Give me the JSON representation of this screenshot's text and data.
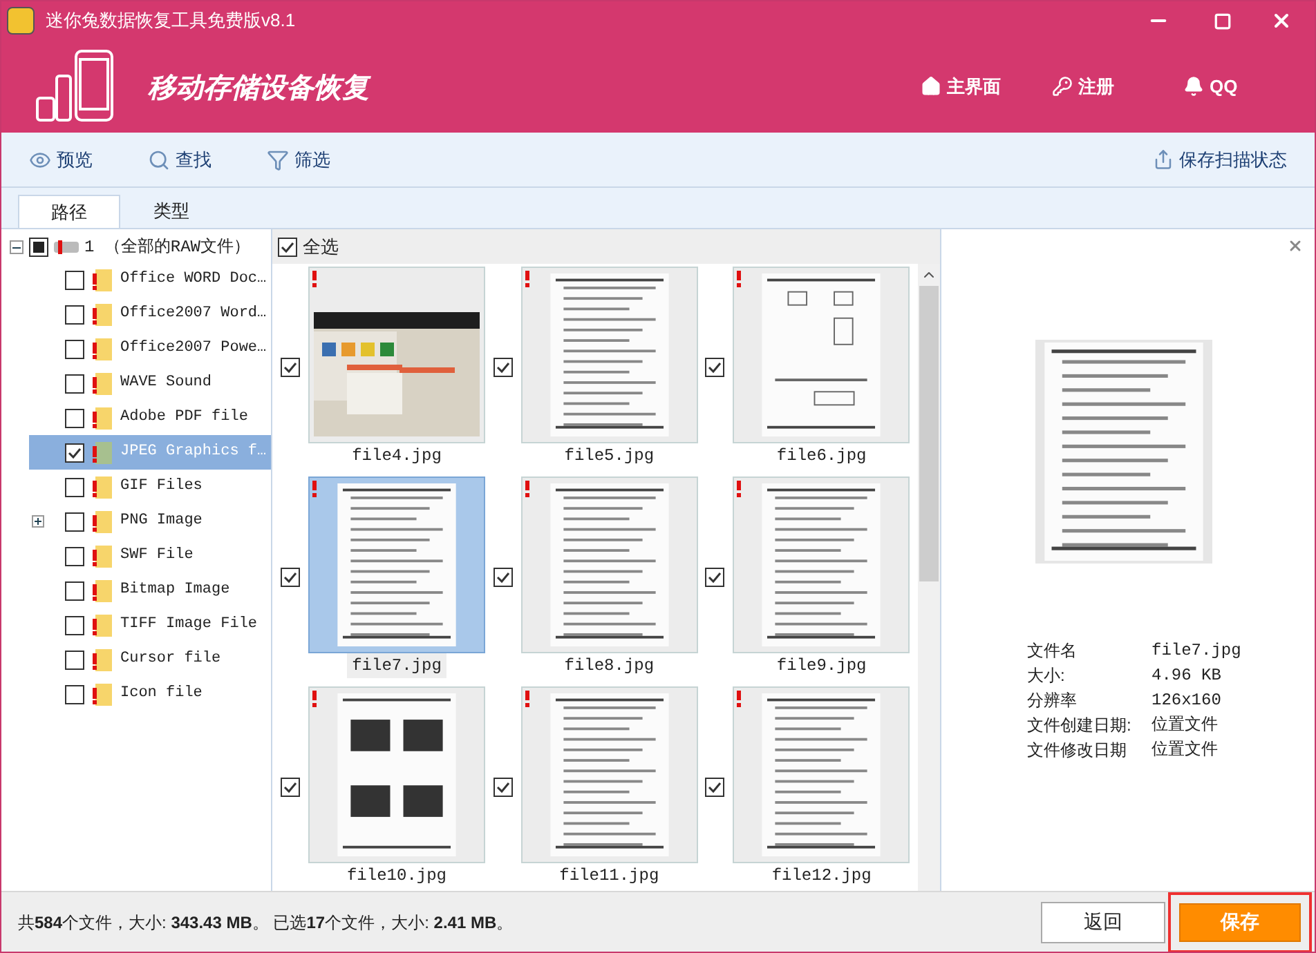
{
  "window": {
    "title": "迷你兔数据恢复工具免费版v8.1"
  },
  "header": {
    "title": "移动存储设备恢复",
    "nav": [
      {
        "kind": "home",
        "label": "主界面"
      },
      {
        "kind": "key",
        "label": "注册"
      },
      {
        "kind": "qq",
        "label": "QQ"
      }
    ]
  },
  "toolbar": {
    "items": [
      {
        "kind": "eye",
        "label": "预览"
      },
      {
        "kind": "search",
        "label": "查找"
      },
      {
        "kind": "filter",
        "label": "筛选"
      }
    ],
    "save_scan": "保存扫描状态"
  },
  "tabs": [
    {
      "label": "路径",
      "selected": true
    },
    {
      "label": "类型",
      "selected": false
    }
  ],
  "tree": {
    "label": "1 （全部的RAW文件）",
    "checked": true,
    "partial": true,
    "expanded": true,
    "children": [
      {
        "label": "Office WORD Doc…",
        "checked": false,
        "selected": false,
        "expandable": false
      },
      {
        "label": "Office2007 Word…",
        "checked": false,
        "selected": false,
        "expandable": false
      },
      {
        "label": "Office2007 Powe…",
        "checked": false,
        "selected": false,
        "expandable": false
      },
      {
        "label": "WAVE Sound",
        "checked": false,
        "selected": false,
        "expandable": false
      },
      {
        "label": "Adobe PDF file",
        "checked": false,
        "selected": false,
        "expandable": false
      },
      {
        "label": "JPEG Graphics f…",
        "checked": true,
        "selected": true,
        "expandable": false
      },
      {
        "label": "GIF Files",
        "checked": false,
        "selected": false,
        "expandable": false
      },
      {
        "label": "PNG Image",
        "checked": false,
        "selected": false,
        "expandable": true
      },
      {
        "label": "SWF File",
        "checked": false,
        "selected": false,
        "expandable": false
      },
      {
        "label": "Bitmap Image",
        "checked": false,
        "selected": false,
        "expandable": false
      },
      {
        "label": "TIFF Image File",
        "checked": false,
        "selected": false,
        "expandable": false
      },
      {
        "label": "Cursor file",
        "checked": false,
        "selected": false,
        "expandable": false
      },
      {
        "label": "Icon file",
        "checked": false,
        "selected": false,
        "expandable": false
      }
    ]
  },
  "grid": {
    "select_all": {
      "label": "全选",
      "checked": true
    },
    "files": [
      {
        "name": "file4.jpg",
        "checked": true,
        "selected": false
      },
      {
        "name": "file5.jpg",
        "kind": "document",
        "checked": true,
        "selected": false
      },
      {
        "name": "file6.jpg",
        "kind": "diagram",
        "checked": true,
        "selected": false
      },
      {
        "name": "file7.jpg",
        "kind": "document",
        "checked": true,
        "selected": true
      },
      {
        "name": "file8.jpg",
        "kind": "document",
        "checked": true,
        "selected": false
      },
      {
        "name": "file9.jpg",
        "kind": "document",
        "checked": true,
        "selected": false
      },
      {
        "name": "file10.jpg",
        "kind": "slides",
        "checked": true,
        "selected": false
      },
      {
        "name": "file11.jpg",
        "kind": "document",
        "checked": true,
        "selected": false
      },
      {
        "name": "file12.jpg",
        "kind": "document",
        "checked": true,
        "selected": false
      }
    ]
  },
  "preview": {
    "info": [
      {
        "label": "文件名",
        "value": "file7.jpg"
      },
      {
        "label": "大小:",
        "value": "4.96 KB"
      },
      {
        "label": "分辨率",
        "value": "126x160"
      },
      {
        "label": "文件创建日期:",
        "value": "位置文件"
      },
      {
        "label": "文件修改日期",
        "value": "位置文件"
      }
    ]
  },
  "status_bar": "共**584**个文件，大小: **343.43 MB**。 已选**17**个文件，大小: **2.41 MB**。",
  "buttons": [
    {
      "kind": "secondary",
      "label": "返回"
    },
    {
      "kind": "primary",
      "label": "保存"
    }
  ]
}
